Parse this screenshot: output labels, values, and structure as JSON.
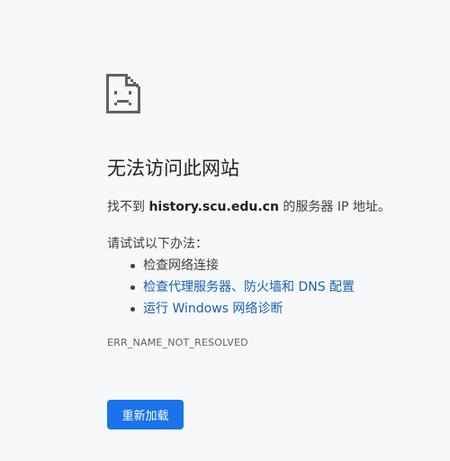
{
  "title": "无法访问此网站",
  "description": {
    "prefix": "找不到 ",
    "host": "history.scu.edu.cn",
    "suffix": " 的服务器 IP 地址。"
  },
  "try_label": "请试试以下办法：",
  "suggestions": [
    {
      "text": "检查网络连接",
      "link": false
    },
    {
      "text": "检查代理服务器、防火墙和 DNS 配置",
      "link": true
    },
    {
      "text": "运行 Windows 网络诊断",
      "link": true
    }
  ],
  "error_code": "ERR_NAME_NOT_RESOLVED",
  "reload_button": "重新加载",
  "colors": {
    "background": "#f7f8fa",
    "link": "#1a5fb4",
    "button": "#1a73e8",
    "icon": "#5f6368"
  },
  "icon": "sad-page-icon"
}
